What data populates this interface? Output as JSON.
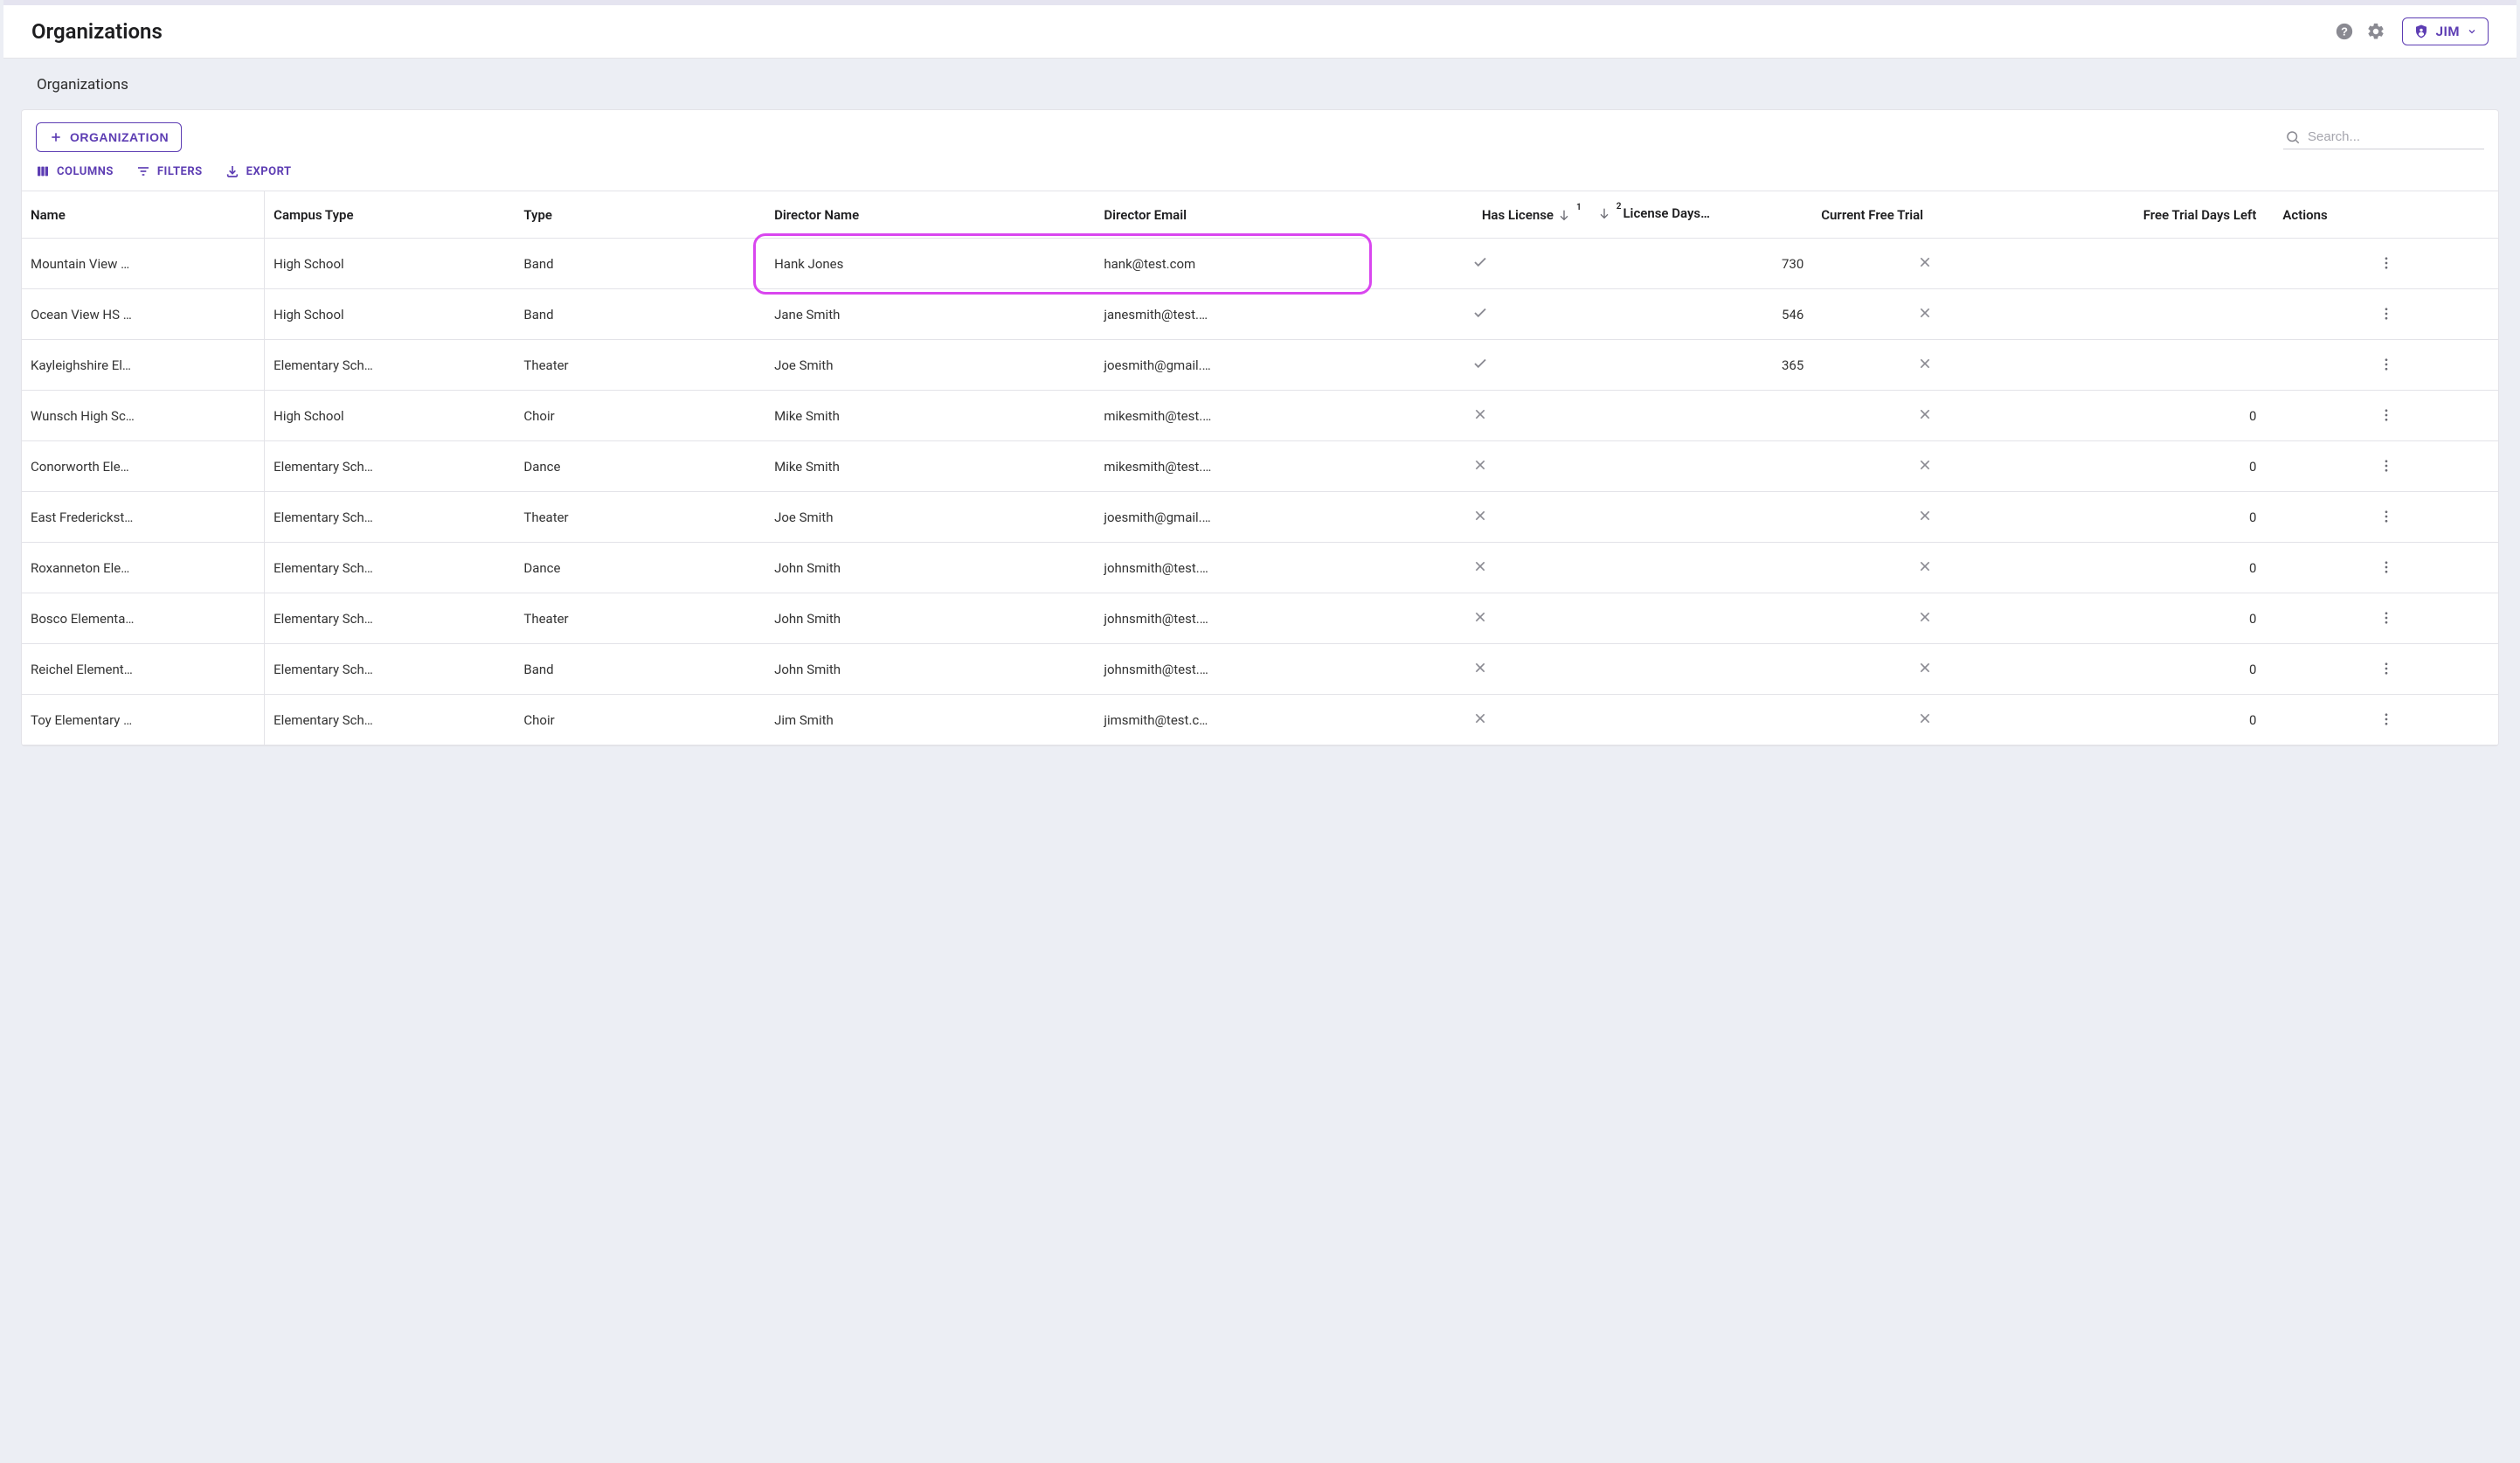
{
  "header": {
    "title": "Organizations"
  },
  "user": {
    "name": "JIM"
  },
  "breadcrumb": "Organizations",
  "toolbar": {
    "add_btn": "ORGANIZATION",
    "columns": "COLUMNS",
    "filters": "FILTERS",
    "export": "EXPORT",
    "search_placeholder": "Search..."
  },
  "columns": {
    "name": "Name",
    "campus_type": "Campus Type",
    "type": "Type",
    "director_name": "Director Name",
    "director_email": "Director Email",
    "has_license": "Has License",
    "license_days": "License Days…",
    "current_free_trial": "Current Free Trial",
    "free_trial_days_left": "Free Trial Days Left",
    "actions": "Actions",
    "sort1": "1",
    "sort2": "2"
  },
  "rows": [
    {
      "name": "Mountain View …",
      "campus": "High School",
      "type": "Band",
      "dname": "Hank Jones",
      "demail": "hank@test.com",
      "has_license": true,
      "license_days": "730",
      "trial": false,
      "trial_days": ""
    },
    {
      "name": "Ocean View HS …",
      "campus": "High School",
      "type": "Band",
      "dname": "Jane Smith",
      "demail": "janesmith@test.…",
      "has_license": true,
      "license_days": "546",
      "trial": false,
      "trial_days": ""
    },
    {
      "name": "Kayleighshire El…",
      "campus": "Elementary Sch…",
      "type": "Theater",
      "dname": "Joe Smith",
      "demail": "joesmith@gmail.…",
      "has_license": true,
      "license_days": "365",
      "trial": false,
      "trial_days": ""
    },
    {
      "name": "Wunsch High Sc…",
      "campus": "High School",
      "type": "Choir",
      "dname": "Mike Smith",
      "demail": "mikesmith@test.…",
      "has_license": false,
      "license_days": "",
      "trial": false,
      "trial_days": "0"
    },
    {
      "name": "Conorworth Ele…",
      "campus": "Elementary Sch…",
      "type": "Dance",
      "dname": "Mike Smith",
      "demail": "mikesmith@test.…",
      "has_license": false,
      "license_days": "",
      "trial": false,
      "trial_days": "0"
    },
    {
      "name": "East Frederickst…",
      "campus": "Elementary Sch…",
      "type": "Theater",
      "dname": "Joe Smith",
      "demail": "joesmith@gmail.…",
      "has_license": false,
      "license_days": "",
      "trial": false,
      "trial_days": "0"
    },
    {
      "name": "Roxanneton Ele…",
      "campus": "Elementary Sch…",
      "type": "Dance",
      "dname": "John Smith",
      "demail": "johnsmith@test.…",
      "has_license": false,
      "license_days": "",
      "trial": false,
      "trial_days": "0"
    },
    {
      "name": "Bosco Elementa…",
      "campus": "Elementary Sch…",
      "type": "Theater",
      "dname": "John Smith",
      "demail": "johnsmith@test.…",
      "has_license": false,
      "license_days": "",
      "trial": false,
      "trial_days": "0"
    },
    {
      "name": "Reichel Element…",
      "campus": "Elementary Sch…",
      "type": "Band",
      "dname": "John Smith",
      "demail": "johnsmith@test.…",
      "has_license": false,
      "license_days": "",
      "trial": false,
      "trial_days": "0"
    },
    {
      "name": "Toy Elementary …",
      "campus": "Elementary Sch…",
      "type": "Choir",
      "dname": "Jim Smith",
      "demail": "jimsmith@test.c…",
      "has_license": false,
      "license_days": "",
      "trial": false,
      "trial_days": "0"
    }
  ]
}
